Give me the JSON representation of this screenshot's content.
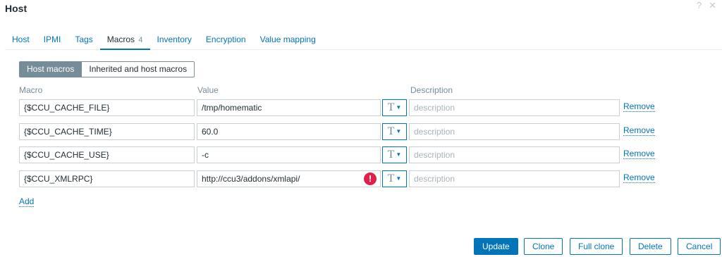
{
  "window": {
    "title": "Host",
    "help_icon": "?",
    "close_icon": "✕"
  },
  "tabs": [
    {
      "label": "Host"
    },
    {
      "label": "IPMI"
    },
    {
      "label": "Tags"
    },
    {
      "label": "Macros",
      "count": "4",
      "active": true
    },
    {
      "label": "Inventory"
    },
    {
      "label": "Encryption"
    },
    {
      "label": "Value mapping"
    }
  ],
  "macro_view": {
    "host_macros": "Host macros",
    "inherited_macros": "Inherited and host macros"
  },
  "columns": {
    "macro": "Macro",
    "value": "Value",
    "description": "Description"
  },
  "rows": [
    {
      "macro": "{$CCU_CACHE_FILE}",
      "value": "/tmp/homematic",
      "type": "T",
      "description_placeholder": "description",
      "remove": "Remove"
    },
    {
      "macro": "{$CCU_CACHE_TIME}",
      "value": "60.0",
      "type": "T",
      "description_placeholder": "description",
      "remove": "Remove"
    },
    {
      "macro": "{$CCU_CACHE_USE}",
      "value": "-c",
      "type": "T",
      "description_placeholder": "description",
      "remove": "Remove"
    },
    {
      "macro": "{$CCU_XMLRPC}",
      "value": "http://ccu3/addons/xmlapi/",
      "type": "T",
      "description_placeholder": "description",
      "remove": "Remove",
      "warning": "!"
    }
  ],
  "add_label": "Add",
  "footer": {
    "update": "Update",
    "clone": "Clone",
    "full_clone": "Full clone",
    "delete": "Delete",
    "cancel": "Cancel"
  },
  "colors": {
    "accent": "#0275b8",
    "warning": "#e0204a",
    "segment_active": "#768d99"
  }
}
